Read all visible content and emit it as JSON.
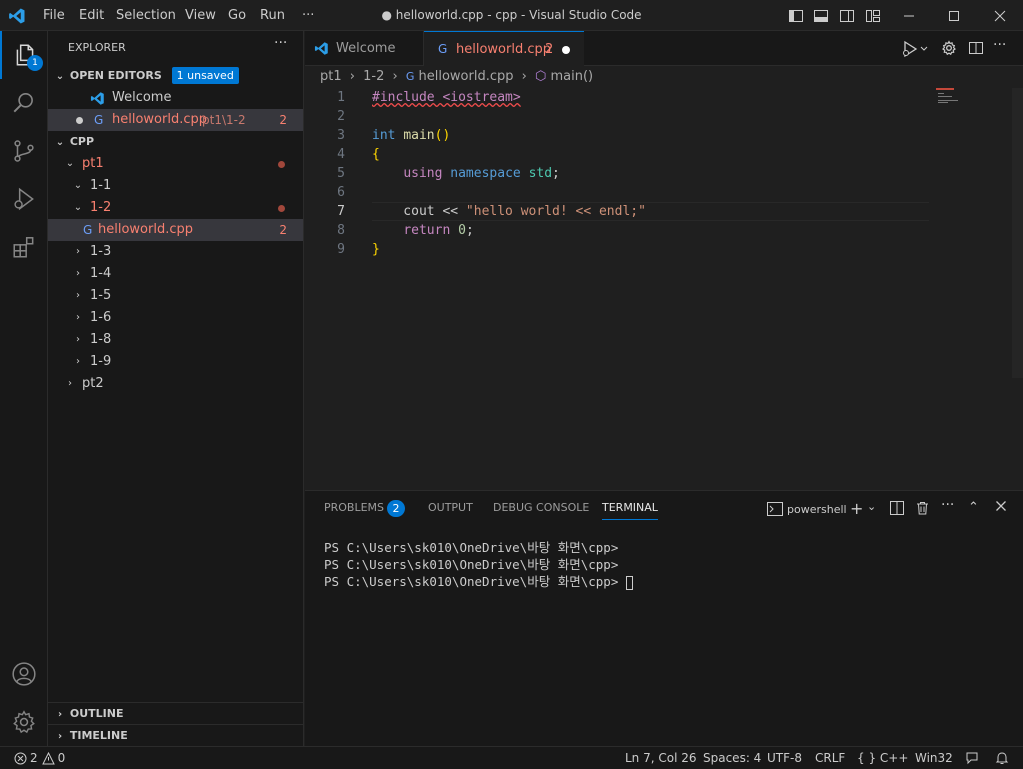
{
  "titlebar": {
    "title": "● helloworld.cpp - cpp - Visual Studio Code",
    "menu": [
      "File",
      "Edit",
      "Selection",
      "View",
      "Go",
      "Run",
      "···"
    ]
  },
  "activitybar": {
    "explorer_badge": "1"
  },
  "sidebar": {
    "title": "EXPLORER",
    "open_editors": {
      "label": "OPEN EDITORS",
      "badge": "1 unsaved",
      "items": [
        {
          "name": "Welcome"
        },
        {
          "name": "helloworld.cpp",
          "path": "pt1\\1-2",
          "problems": "2"
        }
      ]
    },
    "workspace": {
      "label": "CPP",
      "tree": [
        {
          "label": "pt1",
          "expanded": true
        },
        {
          "label": "1-1",
          "expanded": true
        },
        {
          "label": "1-2",
          "expanded": true
        },
        {
          "label": "helloworld.cpp",
          "problems": "2"
        },
        {
          "label": "1-3"
        },
        {
          "label": "1-4"
        },
        {
          "label": "1-5"
        },
        {
          "label": "1-6"
        },
        {
          "label": "1-8"
        },
        {
          "label": "1-9"
        },
        {
          "label": "pt2"
        }
      ]
    },
    "outline": "OUTLINE",
    "timeline": "TIMELINE"
  },
  "tabs": [
    {
      "label": "Welcome"
    },
    {
      "label": "helloworld.cpp",
      "problems": "2"
    }
  ],
  "breadcrumb": [
    "pt1",
    "1-2",
    "helloworld.cpp",
    "main()"
  ],
  "editor": {
    "line_numbers": [
      "1",
      "2",
      "3",
      "4",
      "5",
      "6",
      "7",
      "8",
      "9"
    ],
    "lines": [
      "#include <iostream>",
      "",
      "int main()",
      "{",
      "    using namespace std;",
      "",
      "    cout << \"hello world! << endl;\"",
      "    return 0;",
      "}"
    ]
  },
  "panel": {
    "tabs": [
      "PROBLEMS",
      "OUTPUT",
      "DEBUG CONSOLE",
      "TERMINAL"
    ],
    "problems_count": "2",
    "shell": "powershell",
    "terminal_lines": [
      "PS C:\\Users\\sk010\\OneDrive\\바탕 화면\\cpp>",
      "PS C:\\Users\\sk010\\OneDrive\\바탕 화면\\cpp>",
      "PS C:\\Users\\sk010\\OneDrive\\바탕 화면\\cpp>"
    ]
  },
  "statusbar": {
    "errors": "2",
    "warnings": "0",
    "position": "Ln 7, Col 26",
    "spaces": "Spaces: 4",
    "encoding": "UTF-8",
    "eol": "CRLF",
    "language": "C++",
    "platform": "Win32"
  },
  "colors": {
    "accent": "#0078d4",
    "error": "#f88070"
  }
}
